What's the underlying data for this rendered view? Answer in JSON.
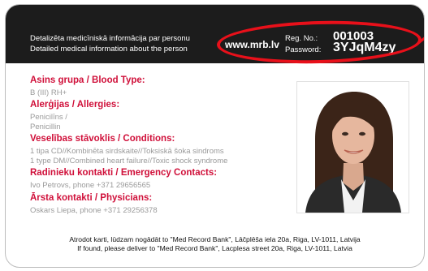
{
  "header": {
    "desc_lv": "Detalizēta medicīniskā informācija par personu",
    "desc_en": "Detailed medical information about the person",
    "site": "www.mrb.lv",
    "reg_label": "Reg. No.:",
    "reg_value": "001003",
    "password_label": "Password:",
    "password_value": "3YJqM4zy"
  },
  "colors": {
    "header_bg": "#1c1c1c",
    "heading_red": "#d0103a",
    "highlight_oval": "#e8101a",
    "body_text": "#9a9a9a"
  },
  "sections": {
    "blood": {
      "heading": "Asins grupa / Blood Type:",
      "lines": [
        "B (III) RH+"
      ]
    },
    "allergies": {
      "heading": "Alerģijas / Allergies:",
      "lines": [
        "Penicilīns /",
        "Penicillin"
      ]
    },
    "conditions": {
      "heading": "Veselības stāvoklis / Conditions:",
      "lines": [
        "1 tipa CD//Kombinēta sirdskaite//Toksiskā šoka sindroms",
        "1 type DM//Combined heart failure//Toxic shock syndrome"
      ]
    },
    "emergency": {
      "heading": "Radinieku kontakti / Emergency Contacts:",
      "lines": [
        "Ivo Petrovs, phone +371 29656565"
      ]
    },
    "physicians": {
      "heading": "Ārsta kontakti / Physicians:",
      "lines": [
        "Oskars Liepa, phone +371 29256378"
      ]
    }
  },
  "footer": {
    "lv": "Atrodot karti, lūdzam nogādāt to \"Med Record Bank\", Lāčplēša iela 20a, Riga, LV-1011, Latvija",
    "en": "If found, please deliver to \"Med Record Bank\", Lacplesa street 20a,  Riga, LV-1011, Latvia"
  },
  "photo": {
    "icon": "person-photo"
  }
}
